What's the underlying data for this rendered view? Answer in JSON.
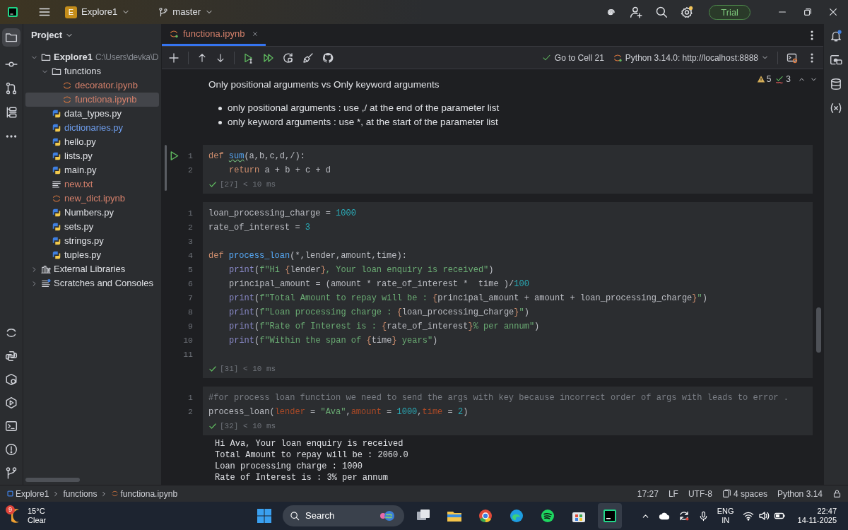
{
  "title_bar": {
    "project_initial": "E",
    "project_name": "Explore1",
    "branch": "master",
    "trial": "Trial"
  },
  "project_panel": {
    "title": "Project",
    "tree": [
      {
        "name": "Explore1",
        "kind": "folder",
        "path": "C:\\Users\\devka\\D",
        "expanded": true,
        "selected": false,
        "color": "#dfe1e5",
        "children": [
          {
            "name": "functions",
            "kind": "folder",
            "expanded": true,
            "selected": false,
            "color": "#dfe1e5",
            "children": [
              {
                "name": "decorator.ipynb",
                "kind": "notebook",
                "selected": false,
                "color": "#d5806b"
              },
              {
                "name": "functiona.ipynb",
                "kind": "notebook",
                "selected": true,
                "color": "#d5806b"
              }
            ]
          },
          {
            "name": "data_types.py",
            "kind": "python",
            "selected": false,
            "color": "#dfe1e5"
          },
          {
            "name": "dictionaries.py",
            "kind": "python",
            "selected": false,
            "color": "#6f9ff0"
          },
          {
            "name": "hello.py",
            "kind": "python",
            "selected": false,
            "color": "#dfe1e5"
          },
          {
            "name": "lists.py",
            "kind": "python",
            "selected": false,
            "color": "#dfe1e5"
          },
          {
            "name": "main.py",
            "kind": "python",
            "selected": false,
            "color": "#dfe1e5"
          },
          {
            "name": "new.txt",
            "kind": "text",
            "selected": false,
            "color": "#d5806b"
          },
          {
            "name": "new_dict.ipynb",
            "kind": "notebook",
            "selected": false,
            "color": "#d5806b"
          },
          {
            "name": "Numbers.py",
            "kind": "python",
            "selected": false,
            "color": "#dfe1e5"
          },
          {
            "name": "sets.py",
            "kind": "python",
            "selected": false,
            "color": "#dfe1e5"
          },
          {
            "name": "strings.py",
            "kind": "python",
            "selected": false,
            "color": "#dfe1e5"
          },
          {
            "name": "tuples.py",
            "kind": "python",
            "selected": false,
            "color": "#dfe1e5"
          }
        ]
      },
      {
        "name": "External Libraries",
        "kind": "libraries",
        "expanded": false,
        "selected": false,
        "color": "#dfe1e5"
      },
      {
        "name": "Scratches and Consoles",
        "kind": "scratches",
        "expanded": false,
        "selected": false,
        "color": "#dfe1e5"
      }
    ]
  },
  "tabs": [
    {
      "label": "functiona.ipynb",
      "selected": true
    }
  ],
  "toolbar": {
    "go_to_cell": "Go to Cell 21",
    "kernel": "Python 3.14.0: http://localhost:8888"
  },
  "inspections": {
    "warnings": "5",
    "typos": "3"
  },
  "markdown": {
    "heading": "Only positional arguments vs Only keyword arguments",
    "bullets": [
      "only positional arguments : use ,/ at the end of the parameter list",
      "only keyword arguments : use *, at the start of the parameter list"
    ]
  },
  "cells": [
    {
      "selected": true,
      "status": "[27] < 10 ms",
      "lines": [
        {
          "n": "1",
          "tokens": [
            {
              "text": "def ",
              "kind": "keyword"
            },
            {
              "text": "sum",
              "kind": "function_warning"
            },
            {
              "text": "(a,b,c,d,/):",
              "kind": "plain"
            }
          ]
        },
        {
          "n": "2",
          "indented": true,
          "tokens": [
            {
              "text": "return",
              "kind": "keyword"
            },
            {
              "text": " a + b + c + d",
              "kind": "plain"
            }
          ]
        }
      ]
    },
    {
      "selected": false,
      "status": "[31] < 10 ms",
      "lines": [
        {
          "n": "1",
          "tokens": [
            {
              "text": "loan_processing_charge = ",
              "kind": "plain"
            },
            {
              "text": "1000",
              "kind": "number"
            }
          ]
        },
        {
          "n": "2",
          "tokens": [
            {
              "text": "rate_of_interest = ",
              "kind": "plain"
            },
            {
              "text": "3",
              "kind": "number"
            }
          ]
        },
        {
          "n": "3"
        },
        {
          "n": "4",
          "tokens": [
            {
              "text": "def ",
              "kind": "keyword"
            },
            {
              "text": "process_loan",
              "kind": "function"
            },
            {
              "text": "(*,lender,amount,time):",
              "kind": "plain"
            }
          ]
        },
        {
          "n": "5",
          "indented": true,
          "tokens": [
            {
              "text": "print",
              "kind": "builtin"
            },
            {
              "text": "(",
              "kind": "plain"
            },
            {
              "text": "f\"Hi ",
              "kind": "string"
            },
            {
              "text": "{",
              "kind": "brace"
            },
            {
              "text": "lender",
              "kind": "plain"
            },
            {
              "text": "}",
              "kind": "brace"
            },
            {
              "text": ", Your loan enquiry is received\"",
              "kind": "string"
            },
            {
              "text": ")",
              "kind": "plain"
            }
          ]
        },
        {
          "n": "6",
          "indented": true,
          "tokens": [
            {
              "text": "principal_amount = (amount * rate_of_interest *  time )/",
              "kind": "plain"
            },
            {
              "text": "100",
              "kind": "number"
            }
          ]
        },
        {
          "n": "7",
          "indented": true,
          "tokens": [
            {
              "text": "print",
              "kind": "builtin"
            },
            {
              "text": "(",
              "kind": "plain"
            },
            {
              "text": "f\"Total Amount to repay will be : ",
              "kind": "string"
            },
            {
              "text": "{",
              "kind": "brace"
            },
            {
              "text": "principal_amount + amount + loan_processing_charge",
              "kind": "plain"
            },
            {
              "text": "}",
              "kind": "brace"
            },
            {
              "text": "\"",
              "kind": "string"
            },
            {
              "text": ")",
              "kind": "plain"
            }
          ]
        },
        {
          "n": "8",
          "indented": true,
          "tokens": [
            {
              "text": "print",
              "kind": "builtin"
            },
            {
              "text": "(",
              "kind": "plain"
            },
            {
              "text": "f\"Loan processing charge : ",
              "kind": "string"
            },
            {
              "text": "{",
              "kind": "brace"
            },
            {
              "text": "loan_processing_charge",
              "kind": "plain"
            },
            {
              "text": "}",
              "kind": "brace"
            },
            {
              "text": "\"",
              "kind": "string"
            },
            {
              "text": ")",
              "kind": "plain"
            }
          ]
        },
        {
          "n": "9",
          "indented": true,
          "tokens": [
            {
              "text": "print",
              "kind": "builtin"
            },
            {
              "text": "(",
              "kind": "plain"
            },
            {
              "text": "f\"Rate of Interest is : ",
              "kind": "string"
            },
            {
              "text": "{",
              "kind": "brace"
            },
            {
              "text": "rate_of_interest",
              "kind": "plain"
            },
            {
              "text": "}",
              "kind": "brace"
            },
            {
              "text": "% per annum\"",
              "kind": "string"
            },
            {
              "text": ")",
              "kind": "plain"
            }
          ]
        },
        {
          "n": "10",
          "indented": true,
          "tokens": [
            {
              "text": "print",
              "kind": "builtin"
            },
            {
              "text": "(",
              "kind": "plain"
            },
            {
              "text": "f\"Within the span of ",
              "kind": "string"
            },
            {
              "text": "{",
              "kind": "brace"
            },
            {
              "text": "time",
              "kind": "plain"
            },
            {
              "text": "}",
              "kind": "brace"
            },
            {
              "text": " years\"",
              "kind": "string"
            },
            {
              "text": ")",
              "kind": "plain"
            }
          ]
        },
        {
          "n": "11"
        }
      ]
    },
    {
      "selected": false,
      "status": "[32] < 10 ms",
      "lines": [
        {
          "n": "1",
          "tokens": [
            {
              "text": "#for process loan function we need to send the args with key because incorrect order of args with leads to error .",
              "kind": "comment"
            }
          ]
        },
        {
          "n": "2",
          "tokens": [
            {
              "text": "process_loan(",
              "kind": "plain"
            },
            {
              "text": "lender",
              "kind": "named_arg"
            },
            {
              "text": " = ",
              "kind": "plain"
            },
            {
              "text": "\"Ava\"",
              "kind": "string"
            },
            {
              "text": ",",
              "kind": "plain"
            },
            {
              "text": "amount",
              "kind": "named_arg"
            },
            {
              "text": " = ",
              "kind": "plain"
            },
            {
              "text": "1000",
              "kind": "number"
            },
            {
              "text": ",",
              "kind": "plain"
            },
            {
              "text": "time",
              "kind": "named_arg"
            },
            {
              "text": " = ",
              "kind": "plain"
            },
            {
              "text": "2",
              "kind": "number"
            },
            {
              "text": ")",
              "kind": "plain"
            }
          ]
        }
      ],
      "output": [
        "Hi Ava, Your loan enquiry is received",
        "Total Amount to repay will be : 2060.0",
        "Loan processing charge : 1000",
        "Rate of Interest is : 3% per annum"
      ]
    }
  ],
  "status_bar": {
    "breadcrumbs": [
      "Explore1",
      "functions",
      "functiona.ipynb"
    ],
    "position": "17:27",
    "line_ending": "LF",
    "encoding": "UTF-8",
    "indent": "4 spaces",
    "interpreter": "Python 3.14"
  },
  "taskbar": {
    "weather_badge": "9",
    "temperature": "15°C",
    "condition": "Clear",
    "search": "Search",
    "language": "ENG",
    "region": "IN",
    "time": "22:47",
    "date": "14-11-2025"
  }
}
